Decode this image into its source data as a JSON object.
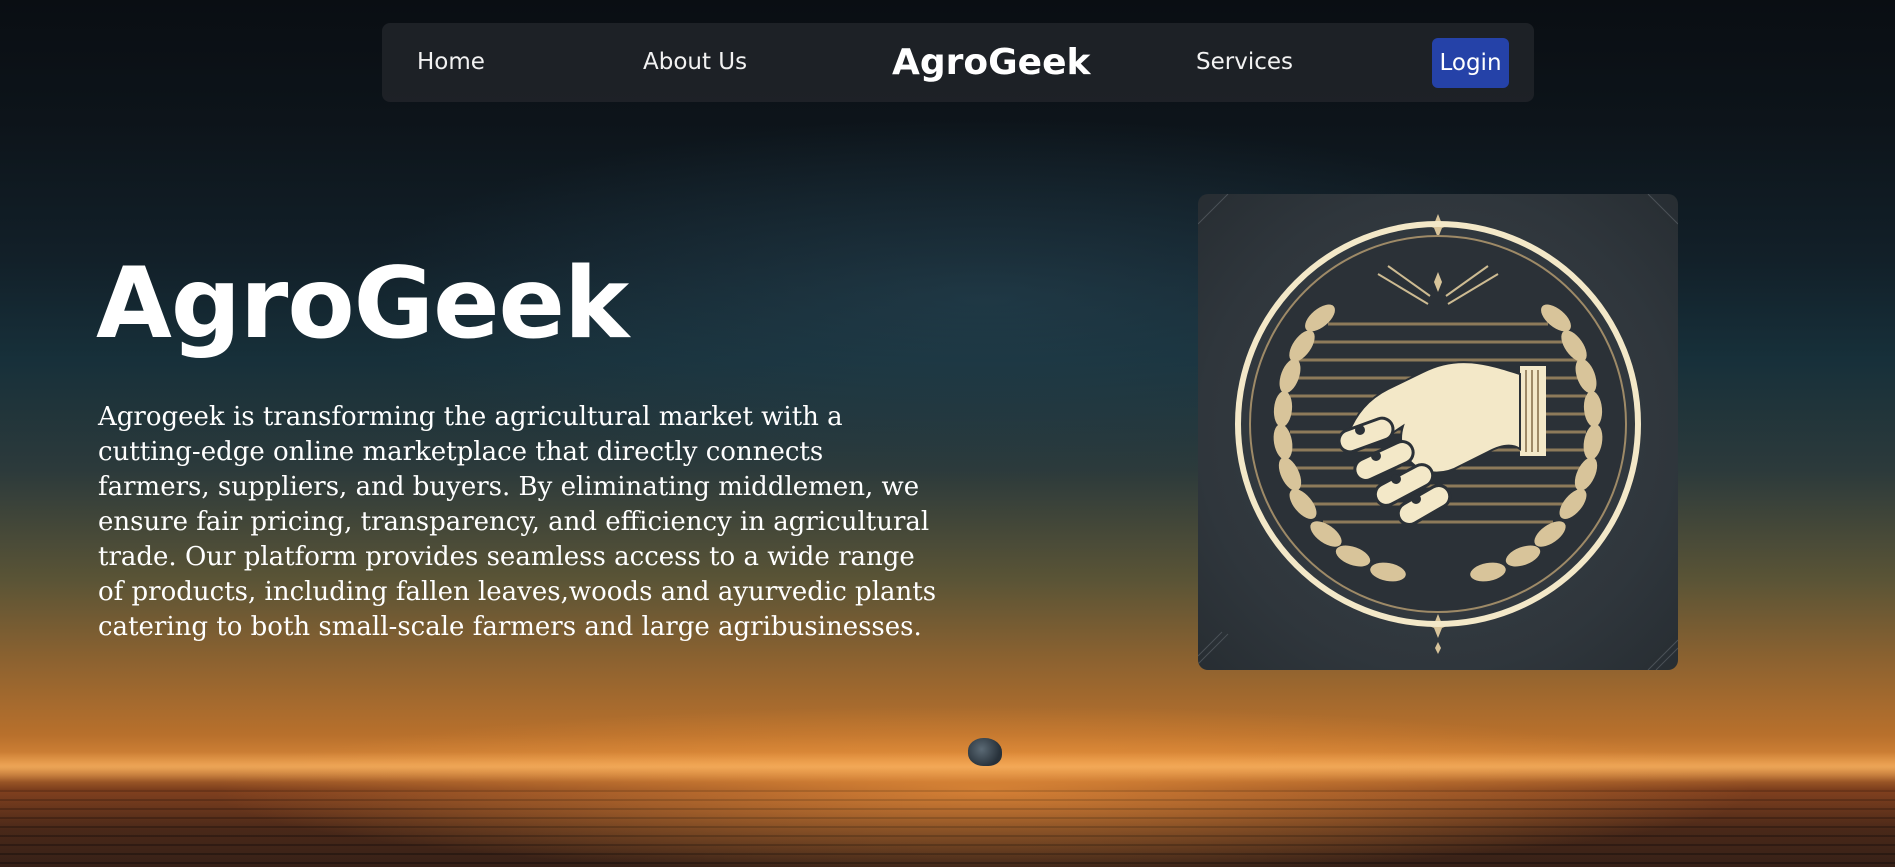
{
  "nav": {
    "home": "Home",
    "about": "About Us",
    "brand": "AgroGeek",
    "services": "Services",
    "login": "Login"
  },
  "hero": {
    "title": "AgroGeek",
    "description": "Agrogeek is transforming the agricultural market with a cutting-edge online marketplace that directly connects farmers, suppliers, and buyers. By eliminating middlemen, we ensure fair pricing, transparency, and efficiency in agricultural trade. Our platform provides seamless access to a wide range of products, including fallen leaves,woods and ayurvedic plants catering to both small-scale farmers and large agribusinesses."
  },
  "emblem": {
    "icon": "handshake-wreath-emblem-icon"
  },
  "colors": {
    "login_button": "#2542a8",
    "navbar": "#202328",
    "emblem_gold": "#d8c49a",
    "emblem_cream": "#f3e8c8"
  }
}
